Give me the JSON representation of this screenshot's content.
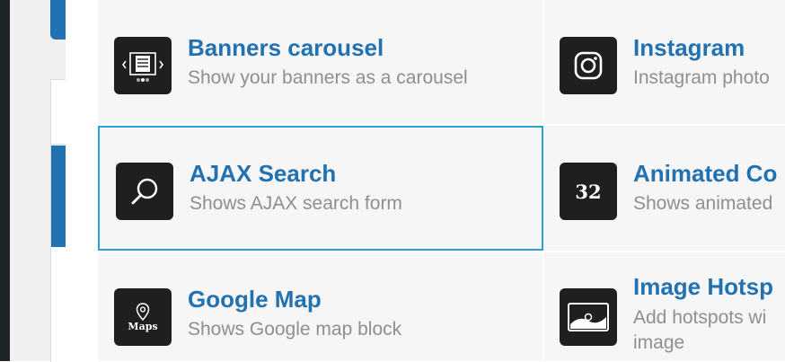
{
  "widgets": [
    {
      "title": "Banners carousel",
      "description": "Show your banners as a carousel",
      "icon": "carousel-icon"
    },
    {
      "title": "Instagram",
      "description": "Instagram photo",
      "icon": "instagram-icon"
    },
    {
      "title": "AJAX Search",
      "description": "Shows AJAX search form",
      "icon": "search-icon"
    },
    {
      "title": "Animated Co",
      "description": "Shows animated",
      "icon": "counter-icon",
      "icon_text": "32"
    },
    {
      "title": "Google Map",
      "description": "Shows Google map block",
      "icon": "map-icon",
      "icon_text": "Maps"
    },
    {
      "title": "Image Hotsp",
      "description_line1": "Add hotspots wi",
      "description_line2": "image",
      "icon": "image-hotspot-icon"
    }
  ],
  "colors": {
    "title": "#2271b1",
    "description": "#8c8f94",
    "tile_bg": "#f6f6f6",
    "selected_border": "#29a3d2",
    "icon_bg": "#1f1f1f"
  }
}
